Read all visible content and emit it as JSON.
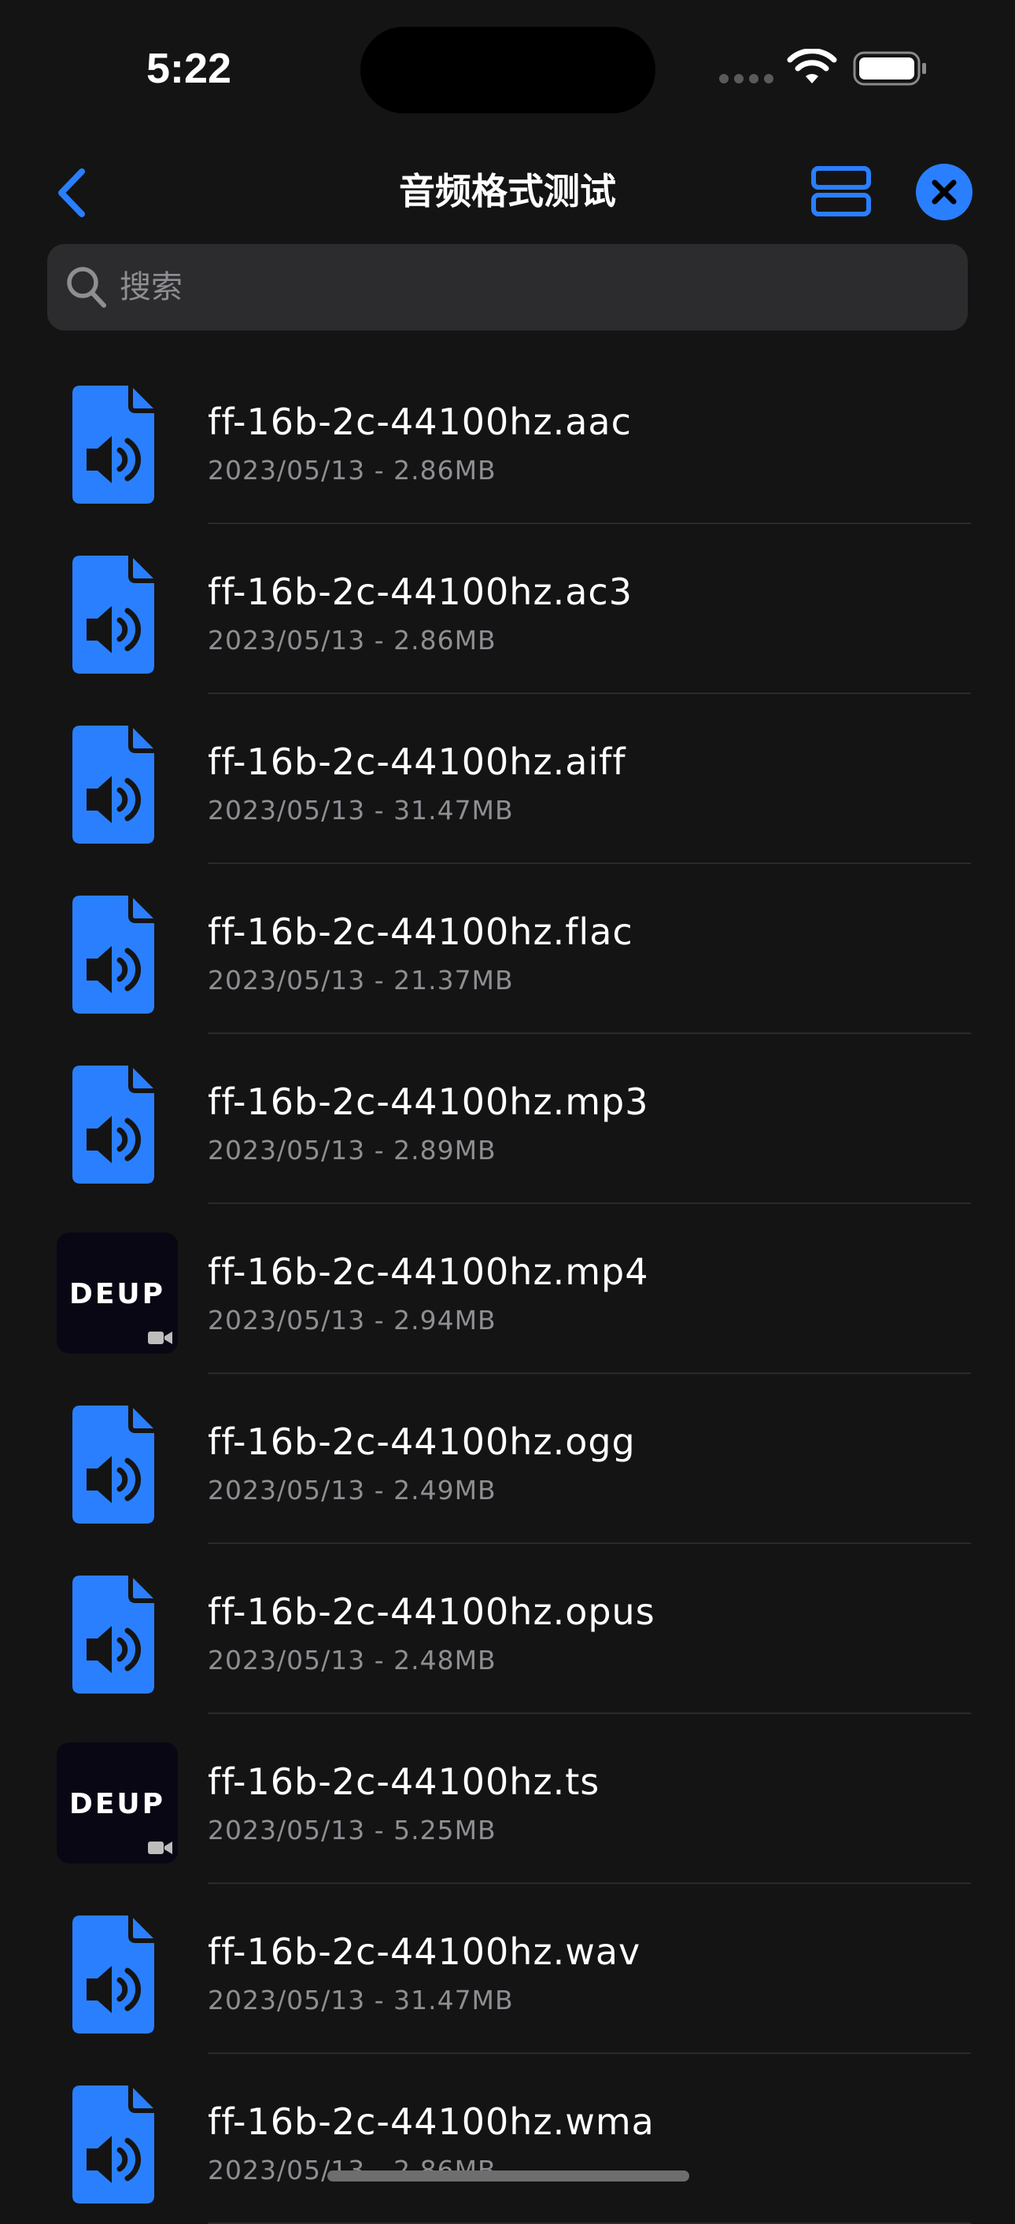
{
  "status_bar": {
    "time": "5:22"
  },
  "nav": {
    "title": "音频格式测试",
    "back_icon": "chevron-left-icon",
    "view_toggle_icon": "rows-layout-icon",
    "close_icon": "xmark-circle-icon"
  },
  "search": {
    "placeholder": "搜索",
    "value": ""
  },
  "colors": {
    "accent": "#2a7fff",
    "background": "#141414",
    "secondary_text": "#8e8e93"
  },
  "files": [
    {
      "name": "ff-16b-2c-44100hz.aac",
      "meta": "2023/05/13 - 2.86MB",
      "icon": "audio-file-icon"
    },
    {
      "name": "ff-16b-2c-44100hz.ac3",
      "meta": "2023/05/13 - 2.86MB",
      "icon": "audio-file-icon"
    },
    {
      "name": "ff-16b-2c-44100hz.aiff",
      "meta": "2023/05/13 - 31.47MB",
      "icon": "audio-file-icon"
    },
    {
      "name": "ff-16b-2c-44100hz.flac",
      "meta": "2023/05/13 - 21.37MB",
      "icon": "audio-file-icon"
    },
    {
      "name": "ff-16b-2c-44100hz.mp3",
      "meta": "2023/05/13 - 2.89MB",
      "icon": "audio-file-icon"
    },
    {
      "name": "ff-16b-2c-44100hz.mp4",
      "meta": "2023/05/13 - 2.94MB",
      "icon": "video-thumbnail",
      "thumb_text": "DEUP"
    },
    {
      "name": "ff-16b-2c-44100hz.ogg",
      "meta": "2023/05/13 - 2.49MB",
      "icon": "audio-file-icon"
    },
    {
      "name": "ff-16b-2c-44100hz.opus",
      "meta": "2023/05/13 - 2.48MB",
      "icon": "audio-file-icon"
    },
    {
      "name": "ff-16b-2c-44100hz.ts",
      "meta": "2023/05/13 - 5.25MB",
      "icon": "video-thumbnail",
      "thumb_text": "DEUP"
    },
    {
      "name": "ff-16b-2c-44100hz.wav",
      "meta": "2023/05/13 - 31.47MB",
      "icon": "audio-file-icon"
    },
    {
      "name": "ff-16b-2c-44100hz.wma",
      "meta": "2023/05/13 - 2.86MB",
      "icon": "audio-file-icon"
    }
  ]
}
